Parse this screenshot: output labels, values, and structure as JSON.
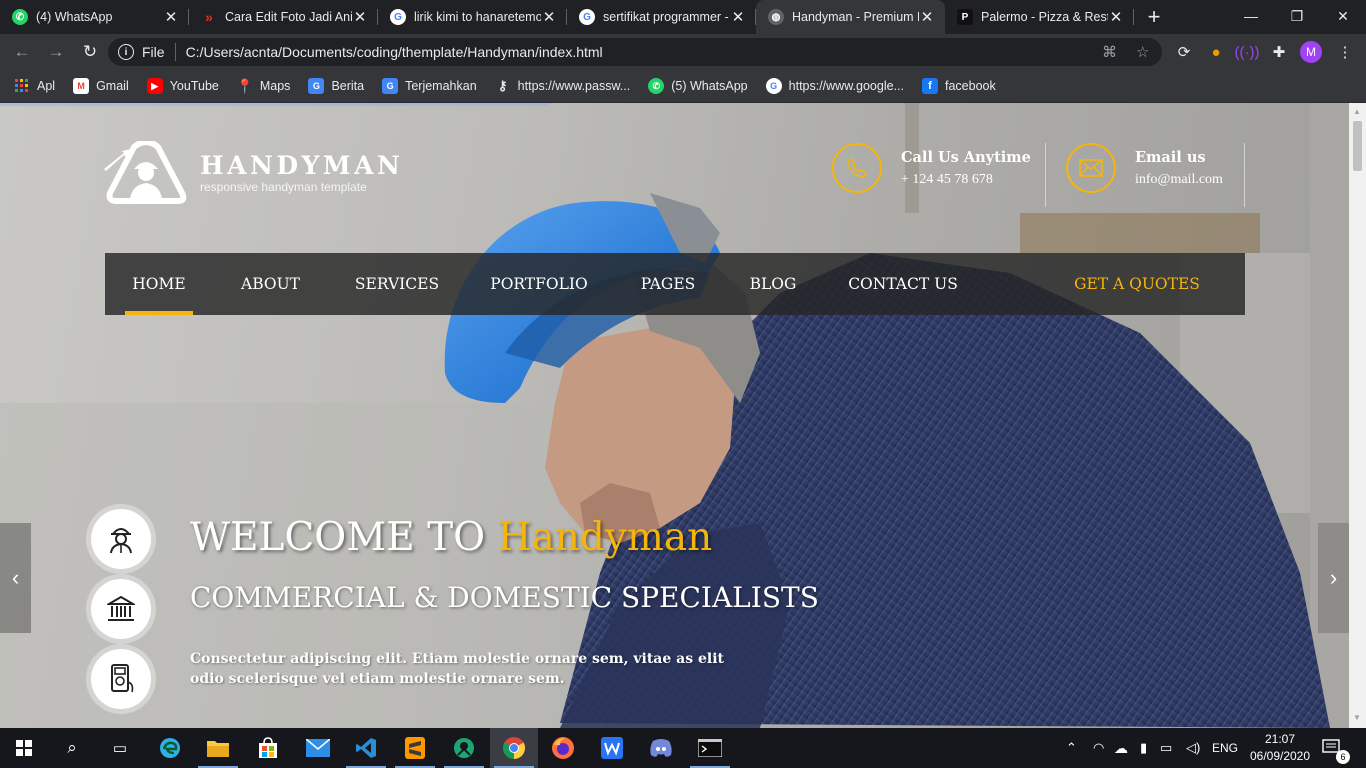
{
  "browser": {
    "tabs": [
      {
        "title": "(4) WhatsApp",
        "favicon": "whatsapp-icon",
        "color": "#25d366",
        "active": false
      },
      {
        "title": "Cara Edit Foto Jadi Anim",
        "favicon": "red-chevron-icon",
        "color": "#e52d27",
        "active": false
      },
      {
        "title": "lirik kimi to hanaretemo",
        "favicon": "google-icon",
        "color": "#4285f4",
        "active": false
      },
      {
        "title": "sertifikat programmer -",
        "favicon": "google-icon",
        "color": "#4285f4",
        "active": false
      },
      {
        "title": "Handyman - Premium H",
        "favicon": "globe-icon",
        "color": "#9aa0a6",
        "active": true
      },
      {
        "title": "Palermo - Pizza & Resta",
        "favicon": "palermo-icon",
        "color": "#222222",
        "active": false
      }
    ],
    "address": {
      "scheme": "File",
      "url": "C:/Users/acnta/Documents/coding/themplate/Handyman/index.html"
    },
    "profile_initial": "M",
    "bookmarks": [
      {
        "label": "Apl",
        "icon": "apps-grid-icon",
        "color": "#ea4335"
      },
      {
        "label": "Gmail",
        "icon": "gmail-icon",
        "color": "#ea4335"
      },
      {
        "label": "YouTube",
        "icon": "youtube-icon",
        "color": "#ff0000"
      },
      {
        "label": "Maps",
        "icon": "maps-icon",
        "color": "#34a853"
      },
      {
        "label": "Berita",
        "icon": "news-icon",
        "color": "#4285f4"
      },
      {
        "label": "Terjemahkan",
        "icon": "translate-icon",
        "color": "#4285f4"
      },
      {
        "label": "https://www.passw...",
        "icon": "key-icon",
        "color": "#9aa0a6"
      },
      {
        "label": "(5) WhatsApp",
        "icon": "whatsapp-icon",
        "color": "#25d366"
      },
      {
        "label": "https://www.google...",
        "icon": "google-icon",
        "color": "#4285f4"
      },
      {
        "label": "facebook",
        "icon": "facebook-icon",
        "color": "#1877f2"
      }
    ]
  },
  "site": {
    "logo": {
      "title": "HANDYMAN",
      "subtitle": "responsive handyman template"
    },
    "call": {
      "label": "Call Us Anytime",
      "value": "+ 124 45 78 678"
    },
    "email": {
      "label": "Email us",
      "value": "info@mail.com"
    },
    "nav": [
      {
        "label": "HOME",
        "active": true
      },
      {
        "label": "ABOUT"
      },
      {
        "label": "SERVICES"
      },
      {
        "label": "PORTFOLIO"
      },
      {
        "label": "PAGES"
      },
      {
        "label": "BLOG"
      },
      {
        "label": "CONTACT US"
      }
    ],
    "cta": "GET A QUOTES",
    "hero": {
      "welcome": "WELCOME TO",
      "brand": "Handyman",
      "subtitle": "COMMERCIAL & DOMESTIC SPECIALISTS",
      "description": "Consectetur adipiscing elit. Etiam molestie ornare sem, vitae as elit odio scelerisque vel etiam molestie ornare sem."
    },
    "accent_color": "#f5b50a"
  },
  "taskbar": {
    "language": "ENG",
    "time": "21:07",
    "date": "06/09/2020",
    "notifications": "6"
  }
}
